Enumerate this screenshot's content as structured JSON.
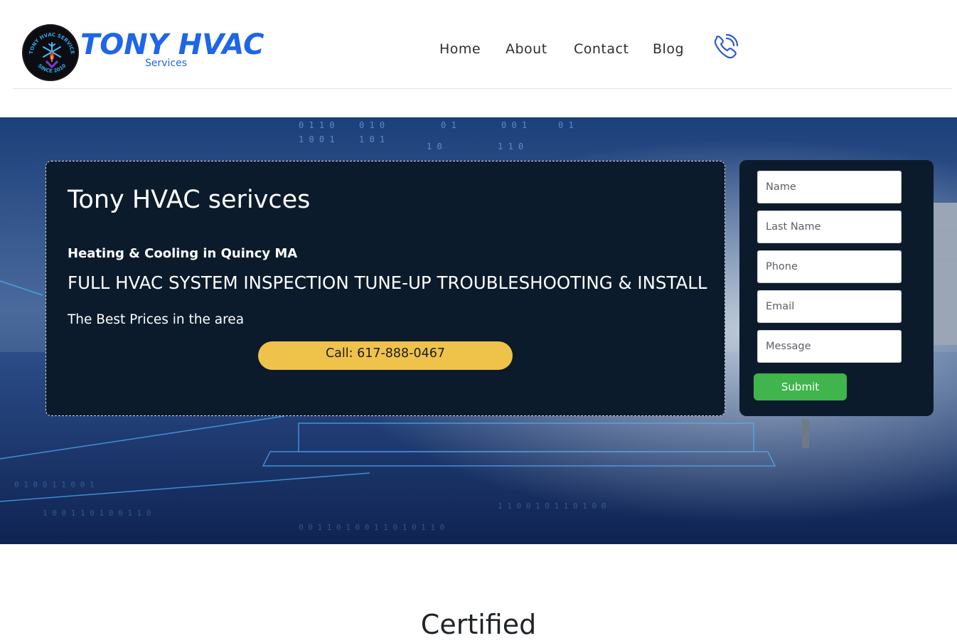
{
  "brand": {
    "title": "TONY HVAC",
    "subtitle": "Services",
    "badge_text_top": "TONY HVAC SERVICE",
    "badge_text_bottom": "SINCE 2010"
  },
  "nav": {
    "items": [
      "Home",
      "About",
      "Contact",
      "Blog"
    ]
  },
  "icons": {
    "phone": "phone-call-icon",
    "logo_snowflake": "snowflake-icon",
    "logo_flame": "flame-icon"
  },
  "hero": {
    "title": "Tony HVAC serivces",
    "subtitle": "Heating & Cooling in Quincy MA",
    "headline": "FULL HVAC SYSTEM INSPECTION TUNE-UP TROUBLESHOOTING & INSTALL",
    "tagline": "The Best Prices in the area",
    "call_label": "Call: 617-888-0467"
  },
  "form": {
    "name_placeholder": "Name",
    "last_name_placeholder": "Last Name",
    "phone_placeholder": "Phone",
    "email_placeholder": "Email",
    "message_placeholder": "Message",
    "submit_label": "Submit"
  },
  "sections": {
    "certified_title": "Certified"
  },
  "colors": {
    "brand_blue": "#1e66e6",
    "card_dark": "#0c1b2b",
    "call_yellow": "#efc24a",
    "submit_green": "#3fb54c"
  }
}
